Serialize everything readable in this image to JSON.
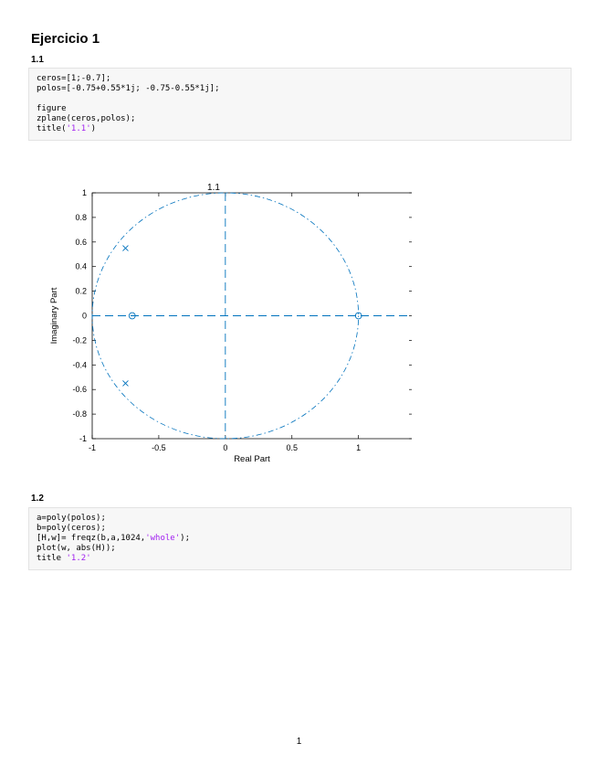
{
  "heading": "Ejercicio 1",
  "sections": [
    {
      "label": "1.1",
      "code": [
        [
          {
            "t": "ceros=[1;-0.7];"
          }
        ],
        [
          {
            "t": "polos=[-0.75+0.55*1j; -0.75-0.55*1j];"
          }
        ],
        [
          {
            "t": ""
          }
        ],
        [
          {
            "t": "figure"
          }
        ],
        [
          {
            "t": "zplane(ceros,polos);"
          }
        ],
        [
          {
            "t": "title("
          },
          {
            "t": "'1.1'",
            "s": 1
          },
          {
            "t": ")"
          }
        ]
      ]
    },
    {
      "label": "1.2",
      "code": [
        [
          {
            "t": "a=poly(polos);"
          }
        ],
        [
          {
            "t": "b=poly(ceros);"
          }
        ],
        [
          {
            "t": "[H,w]= freqz(b,a,1024,"
          },
          {
            "t": "'whole'",
            "s": 1
          },
          {
            "t": ");"
          }
        ],
        [
          {
            "t": "plot(w, abs(H));"
          }
        ],
        [
          {
            "t": "title "
          },
          {
            "t": "'1.2'",
            "s": 1
          }
        ]
      ]
    }
  ],
  "chart_data": {
    "type": "scatter",
    "title": "1.1",
    "xlabel": "Real Part",
    "ylabel": "Imaginary Part",
    "xlim": [
      -1.0,
      1.4
    ],
    "ylim": [
      -1.0,
      1.0
    ],
    "x_ticks": [
      -1,
      -0.5,
      0,
      0.5,
      1
    ],
    "x_tick_labels": [
      "-1",
      "-0.5",
      "0",
      "0.5",
      "1"
    ],
    "y_ticks": [
      1,
      0.8,
      0.6,
      0.4,
      0.2,
      0,
      -0.2,
      -0.4,
      -0.6,
      -0.8,
      -1
    ],
    "y_tick_labels": [
      "1",
      "0.8",
      "0.6",
      "0.4",
      "0.2",
      "0",
      "-0.2",
      "-0.4",
      "-0.6",
      "-0.8",
      "-1"
    ],
    "unit_circle": true,
    "zeros": [
      [
        1,
        0
      ],
      [
        -0.7,
        0
      ]
    ],
    "poles": [
      [
        -0.75,
        0.55
      ],
      [
        -0.75,
        -0.55
      ]
    ],
    "line_color": "#0072bd"
  },
  "page_number": "1"
}
